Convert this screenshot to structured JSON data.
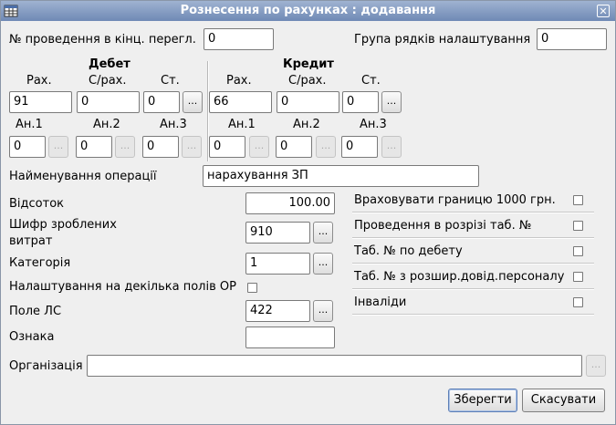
{
  "window": {
    "title": "Рознесення по рахунках : додавання",
    "close_glyph": "✕"
  },
  "top": {
    "posting_label": "№ проведення в кінц. перегл.",
    "posting_value": "0",
    "group_label": "Група рядків налаштування",
    "group_value": "0"
  },
  "debit": {
    "header": "Дебет",
    "col_acc": "Рах.",
    "col_sub": "С/рах.",
    "col_st": "Ст.",
    "acc": "91",
    "sub": "0",
    "st": "0",
    "an1_label": "Ан.1",
    "an2_label": "Ан.2",
    "an3_label": "Ан.3",
    "an1": "0",
    "an2": "0",
    "an3": "0"
  },
  "credit": {
    "header": "Кредит",
    "col_acc": "Рах.",
    "col_sub": "С/рах.",
    "col_st": "Ст.",
    "acc": "66",
    "sub": "0",
    "st": "0",
    "an1_label": "Ан.1",
    "an2_label": "Ан.2",
    "an3_label": "Ан.3",
    "an1": "0",
    "an2": "0",
    "an3": "0"
  },
  "operation": {
    "label": "Найменування операції",
    "value": "нарахування ЗП"
  },
  "left": {
    "percent_label": "Відсоток",
    "percent_value": "100.00",
    "cost_label_line1": "Шифр зроблених",
    "cost_label_line2": "витрат",
    "cost_value": "910",
    "category_label": "Категорія",
    "category_value": "1",
    "multi_label": "Налаштування на декілька полів ОР",
    "ls_label": "Поле ЛС",
    "ls_value": "422",
    "sign_label": "Ознака",
    "sign_value": ""
  },
  "options": [
    {
      "label": "Враховувати границю 1000 грн.",
      "checked": false
    },
    {
      "label": "Проведення в розрізі таб. №",
      "checked": false
    },
    {
      "label": "Таб. № по дебету",
      "checked": false
    },
    {
      "label": "Таб. № з розшир.довід.персоналу",
      "checked": false
    },
    {
      "label": "Інваліди",
      "checked": false
    }
  ],
  "org": {
    "label": "Організація",
    "value": ""
  },
  "buttons": {
    "ellipsis": "...",
    "save": "Зберегти",
    "cancel": "Скасувати"
  }
}
